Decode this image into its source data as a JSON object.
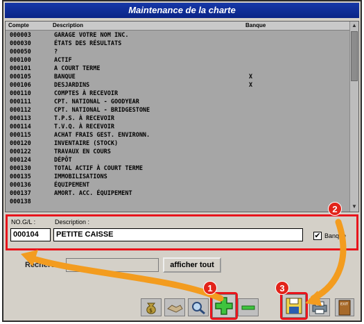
{
  "window": {
    "title": "Maintenance de la charte"
  },
  "table": {
    "columns": [
      "Compte",
      "Description",
      "Banque"
    ],
    "rows": [
      {
        "code": "000003",
        "desc": "GARAGE VOTRE NOM INC.",
        "bank": ""
      },
      {
        "code": "000030",
        "desc": "ÉTATS DES RÉSULTATS",
        "bank": ""
      },
      {
        "code": "000050",
        "desc": "?",
        "bank": ""
      },
      {
        "code": "000100",
        "desc": "ACTIF",
        "bank": ""
      },
      {
        "code": "000101",
        "desc": "A COURT TERME",
        "bank": ""
      },
      {
        "code": "000105",
        "desc": "BANQUE",
        "bank": "X"
      },
      {
        "code": "000106",
        "desc": "DESJARDINS",
        "bank": "X"
      },
      {
        "code": "000110",
        "desc": "COMPTES À RECEVOIR",
        "bank": ""
      },
      {
        "code": "000111",
        "desc": "CPT. NATIONAL - GOODYEAR",
        "bank": ""
      },
      {
        "code": "000112",
        "desc": "CPT. NATIONAL - BRIDGESTONE",
        "bank": ""
      },
      {
        "code": "000113",
        "desc": "T.P.S. À RECEVOIR",
        "bank": ""
      },
      {
        "code": "000114",
        "desc": "T.V.Q. À RECEVOIR",
        "bank": ""
      },
      {
        "code": "000115",
        "desc": "ACHAT FRAIS GEST. ENVIRONN.",
        "bank": ""
      },
      {
        "code": "000120",
        "desc": "INVENTAIRE (STOCK)",
        "bank": ""
      },
      {
        "code": "000122",
        "desc": "TRAVAUX EN COURS",
        "bank": ""
      },
      {
        "code": "000124",
        "desc": "DÉPÔT",
        "bank": ""
      },
      {
        "code": "000130",
        "desc": "TOTAL ACTIF À COURT TERME",
        "bank": ""
      },
      {
        "code": "000135",
        "desc": "IMMOBILISATIONS",
        "bank": ""
      },
      {
        "code": "000136",
        "desc": "ÉQUIPEMENT",
        "bank": ""
      },
      {
        "code": "000137",
        "desc": "AMORT. ACC. ÉQUIPEMENT",
        "bank": ""
      },
      {
        "code": "000138",
        "desc": "",
        "bank": ""
      }
    ]
  },
  "form": {
    "gl_label": "NO.G/L :",
    "gl_value": "000104",
    "desc_label": "Description :",
    "desc_value": "PETITE CAISSE",
    "bank_label": "Banque",
    "bank_checked": "✔"
  },
  "search": {
    "label": "Recherche:",
    "value": "",
    "show_all": "afficher tout"
  },
  "annotations": {
    "badge1": "1",
    "badge2": "2",
    "badge3": "3"
  },
  "colors": {
    "accent": "#e8141c",
    "arrow": "#f39c1f",
    "titlebar": "#0a2486"
  },
  "icons": [
    "money-bag-icon",
    "handshake-icon",
    "magnifier-icon",
    "add-plus-icon",
    "remove-minus-icon",
    "save-disk-icon",
    "printer-icon",
    "exit-door-icon"
  ]
}
